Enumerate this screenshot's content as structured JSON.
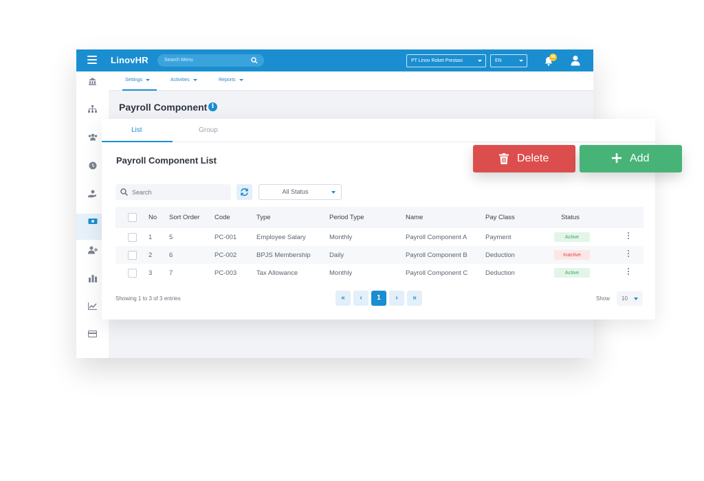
{
  "app": {
    "brand": "LinovHR",
    "search_placeholder": "Search Menu",
    "company_select": "PT Linov Roket Prestasi",
    "language_select": "EN",
    "notification_count": "99"
  },
  "subnav": {
    "items": [
      "Settings",
      "Activities",
      "Reports"
    ]
  },
  "page": {
    "title": "Payroll Component"
  },
  "tabs": [
    "List",
    "Group"
  ],
  "list": {
    "title": "Payroll Component List",
    "search_placeholder": "Search",
    "status_filter": "All Status",
    "columns": [
      "No",
      "Sort Order",
      "Code",
      "Type",
      "Period Type",
      "Name",
      "Pay Class",
      "Status"
    ],
    "rows": [
      {
        "no": "1",
        "sort": "5",
        "code": "PC-001",
        "type": "Employee Salary",
        "period": "Monthly",
        "name": "Payroll Component A",
        "pay_class": "Payment",
        "status": "Active"
      },
      {
        "no": "2",
        "sort": "6",
        "code": "PC-002",
        "type": "BPJS Membership",
        "period": "Daily",
        "name": "Payroll Component B",
        "pay_class": "Deduction",
        "status": "Inactive"
      },
      {
        "no": "3",
        "sort": "7",
        "code": "PC-003",
        "type": "Tax Allowance",
        "period": "Monthly",
        "name": "Payroll Component C",
        "pay_class": "Deduction",
        "status": "Active"
      }
    ],
    "footer": "Showing 1 to 3 of 3 entries",
    "pagination": {
      "first": "«",
      "prev": "‹",
      "current": "1",
      "next": "›",
      "last": "»"
    },
    "show_label": "Show",
    "page_size": "10"
  },
  "actions": {
    "delete_label": "Delete",
    "add_label": "Add"
  },
  "colors": {
    "primary": "#1a8ed0",
    "delete": "#dc4e4e",
    "add": "#48b377",
    "active": "#3aa764",
    "inactive": "#d84b4b"
  }
}
